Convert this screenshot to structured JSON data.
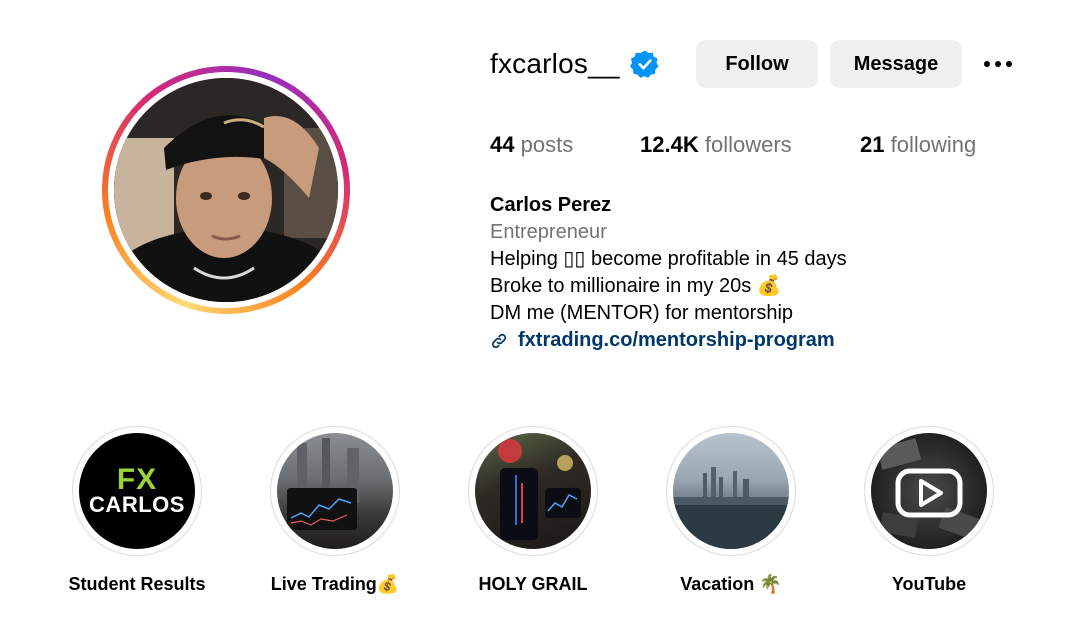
{
  "profile": {
    "username": "fxcarlos__",
    "verified_icon": "verified-badge-icon",
    "follow_label": "Follow",
    "message_label": "Message",
    "more_icon": "more-options-icon",
    "stats": {
      "posts_count": "44",
      "posts_label": "posts",
      "followers_count": "12.4K",
      "followers_label": "followers",
      "following_count": "21",
      "following_label": "following"
    },
    "bio": {
      "name": "Carlos Perez",
      "category": "Entrepreneur",
      "lines": [
        "Helping ▯▯ become profitable in 45 days",
        "Broke to millionaire in my 20s 💰",
        "DM me (MENTOR) for mentorship"
      ],
      "link_icon": "link-icon",
      "link": "fxtrading.co/mentorship-program"
    }
  },
  "highlights": [
    {
      "label": "Student Results",
      "icon": "fx-carlos-logo",
      "logo_text_top": "FX",
      "logo_text_bottom": "CARLOS"
    },
    {
      "label": "Live Trading💰",
      "icon": "laptop-trading-photo"
    },
    {
      "label": "HOLY GRAIL",
      "icon": "phone-chart-photo"
    },
    {
      "label": "Vacation 🌴",
      "icon": "city-skyline-photo"
    },
    {
      "label": "YouTube",
      "icon": "youtube-play-icon"
    }
  ],
  "colors": {
    "button_bg": "#efefef",
    "secondary_text": "#737373",
    "link": "#00376b",
    "verified": "#0095f6",
    "fx_green": "#9ad33a"
  }
}
